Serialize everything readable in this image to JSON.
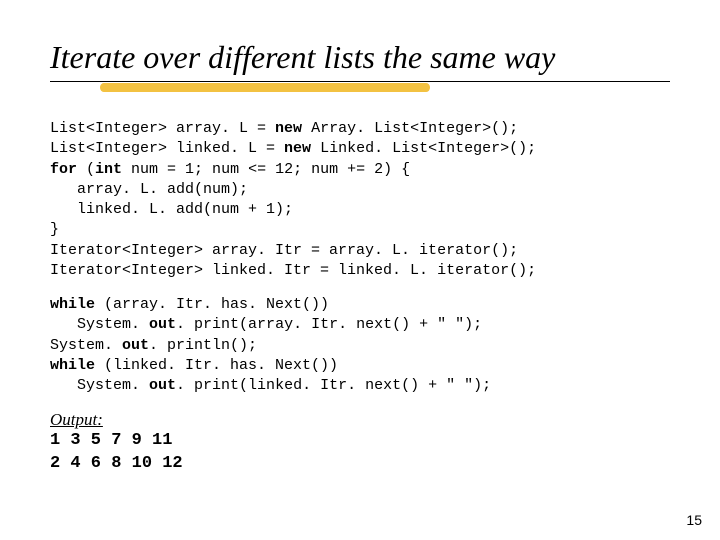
{
  "title": "Iterate over different lists the same way",
  "code_block1": [
    {
      "plain": "List<Integer> array. L = ",
      "kw": "new",
      "tail": " Array. List<Integer>();"
    },
    {
      "plain": "List<Integer> linked. L = ",
      "kw": "new",
      "tail": " Linked. List<Integer>();"
    },
    {
      "kw": "for",
      "plain": " (",
      "kw2": "int",
      "tail": " num = 1; num <= 12; num += 2) {"
    },
    {
      "plain": "   array. L. add(num);"
    },
    {
      "plain": "   linked. L. add(num + 1);"
    },
    {
      "plain": "}"
    },
    {
      "plain": "Iterator<Integer> array. Itr = array. L. iterator();"
    },
    {
      "plain": "Iterator<Integer> linked. Itr = linked. L. iterator();"
    }
  ],
  "code_block2": [
    {
      "kw": "while",
      "tail": " (array. Itr. has. Next())"
    },
    {
      "plain": "   System. ",
      "kw": "out",
      "tail": ". print(array. Itr. next() + \" \");"
    },
    {
      "plain": "System. ",
      "kw": "out",
      "tail": ". println();"
    },
    {
      "kw": "while",
      "tail": " (linked. Itr. has. Next())"
    },
    {
      "plain": "   System. ",
      "kw": "out",
      "tail": ". print(linked. Itr. next() + \" \");"
    }
  ],
  "output_label": "Output:",
  "output_lines": [
    "1 3 5 7 9 11",
    "2 4 6 8 10 12"
  ],
  "page_number": "15"
}
